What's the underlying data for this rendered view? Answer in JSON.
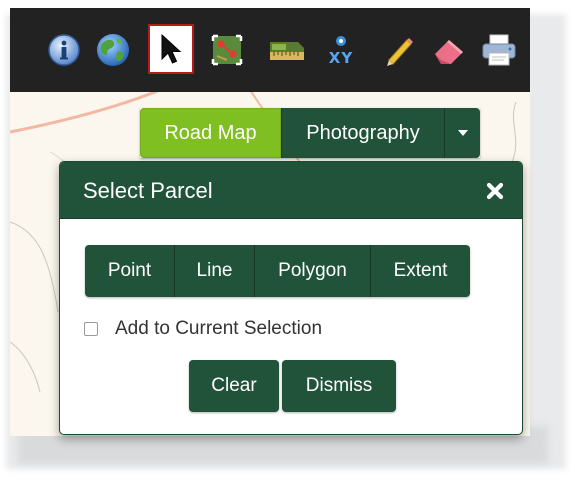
{
  "toolbar": {
    "tools": [
      {
        "icon": "info-icon",
        "active": false
      },
      {
        "icon": "globe-icon",
        "active": false
      },
      {
        "icon": "select-arrow-icon",
        "active": true
      },
      {
        "icon": "select-parcel-icon",
        "active": false
      },
      {
        "icon": "measure-ruler-icon",
        "active": false
      },
      {
        "icon": "xy-coordinates-icon",
        "active": false
      },
      {
        "icon": "pencil-icon",
        "active": false
      },
      {
        "icon": "eraser-icon",
        "active": false
      },
      {
        "icon": "printer-icon",
        "active": false
      }
    ],
    "xy_label": "XY",
    "background": "#222222",
    "active_border": "#b41c1c"
  },
  "basemap": {
    "road_map_label": "Road Map",
    "photography_label": "Photography",
    "selected": "Road Map",
    "selected_color": "#7fbf22",
    "button_color": "#205339"
  },
  "dialog": {
    "title": "Select Parcel",
    "close_symbol": "✖",
    "draw_buttons": [
      "Point",
      "Line",
      "Polygon",
      "Extent"
    ],
    "add_to_selection": {
      "label": "Add to Current Selection",
      "checked": false
    },
    "clear_label": "Clear",
    "dismiss_label": "Dismiss",
    "header_color": "#205339"
  },
  "map": {
    "background": "#fbf7ee",
    "road_color": "#f2b8a2"
  }
}
